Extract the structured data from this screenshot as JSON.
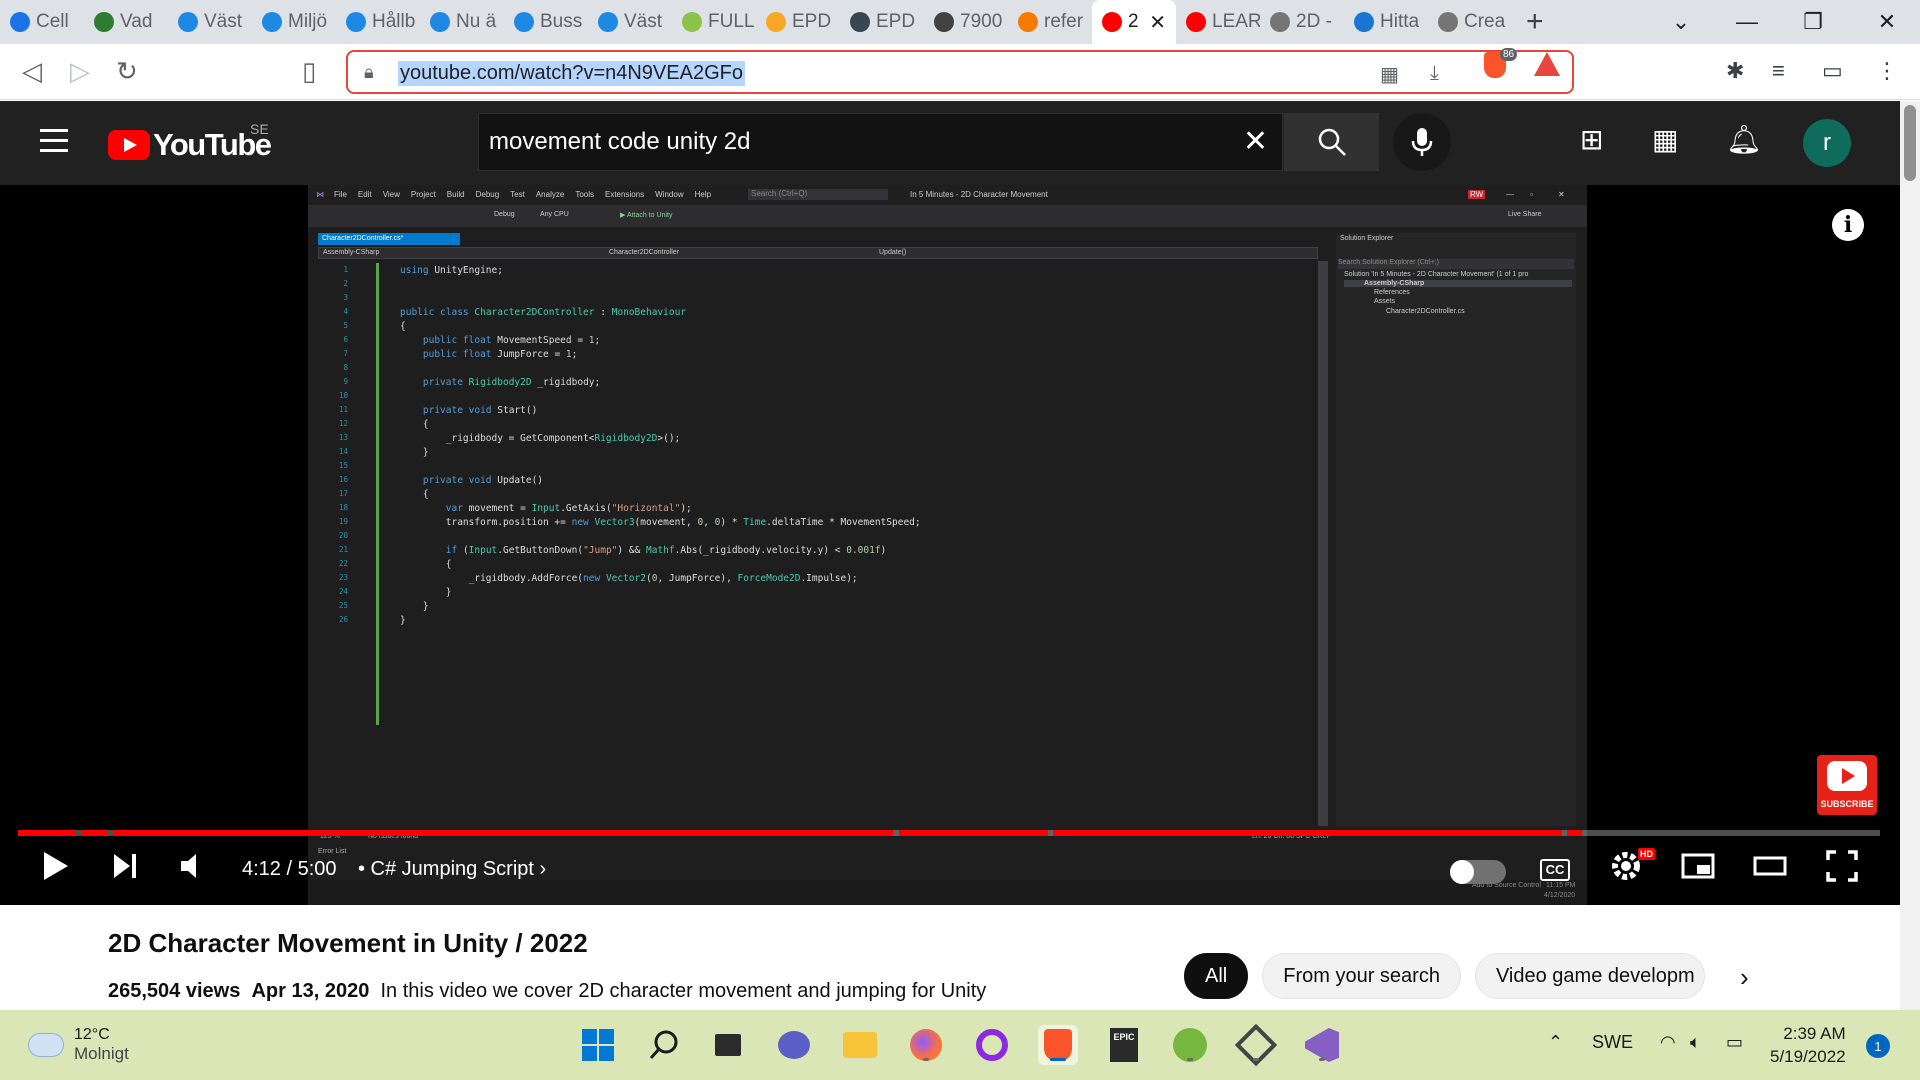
{
  "browser": {
    "tabs": [
      {
        "label": "Cell",
        "favicon": "c-icon",
        "color": "#1a73e8"
      },
      {
        "label": "Vad",
        "favicon": "vad-icon",
        "color": "#2e7d32"
      },
      {
        "label": "Väst",
        "favicon": "vastrafik-icon",
        "color": "#1e88e5"
      },
      {
        "label": "Miljö",
        "favicon": "vastrafik-icon",
        "color": "#1e88e5"
      },
      {
        "label": "Hållb",
        "favicon": "vastrafik-icon",
        "color": "#1e88e5"
      },
      {
        "label": "Nu ä",
        "favicon": "vastrafik-icon",
        "color": "#1e88e5"
      },
      {
        "label": "Buss",
        "favicon": "vastrafik-icon",
        "color": "#1e88e5"
      },
      {
        "label": "Väst",
        "favicon": "vastrafik-icon",
        "color": "#1e88e5"
      },
      {
        "label": "FULL",
        "favicon": "plant-icon",
        "color": "#8bc34a"
      },
      {
        "label": "EPD",
        "favicon": "epd-icon",
        "color": "#f9a825"
      },
      {
        "label": "EPD",
        "favicon": "epd-dark-icon",
        "color": "#37474f"
      },
      {
        "label": "7900",
        "favicon": "gauge-icon",
        "color": "#424242"
      },
      {
        "label": "refer",
        "favicon": "globe-icon",
        "color": "#f57c00"
      },
      {
        "label": "2",
        "favicon": "youtube-icon",
        "color": "#ff0000",
        "active": true
      },
      {
        "label": "LEAR",
        "favicon": "youtube-icon",
        "color": "#ff0000"
      },
      {
        "label": "2D -",
        "favicon": "unity-icon",
        "color": "#757575"
      },
      {
        "label": "Hitta",
        "favicon": "b-icon",
        "color": "#1976d2"
      },
      {
        "label": "Crea",
        "favicon": "unity-icon",
        "color": "#757575"
      }
    ],
    "url": "youtube.com/watch?v=n4N9VEA2GFo",
    "brave_badge": "86"
  },
  "youtube": {
    "logo_text": "YouTube",
    "region": "SE",
    "search_query": "movement code unity 2d",
    "avatar_letter": "r"
  },
  "player": {
    "current_time": "4:12",
    "duration": "5:00",
    "time_display": "4:12 / 5:00",
    "chapter": "• C# Jumping Script",
    "progress_fraction": 0.84,
    "subscribe_label": "SUBSCRIBE",
    "cc_label": "CC",
    "hd_label": "HD",
    "chapter_segments": [
      [
        0,
        0.031
      ],
      [
        0.034,
        0.048
      ],
      [
        0.051,
        0.47
      ],
      [
        0.473,
        0.553
      ],
      [
        0.556,
        0.829
      ],
      [
        0.832,
        0.84
      ]
    ]
  },
  "video_frame": {
    "menu": [
      "File",
      "Edit",
      "View",
      "Project",
      "Build",
      "Debug",
      "Test",
      "Analyze",
      "Tools",
      "Extensions",
      "Window",
      "Help"
    ],
    "search_placeholder": "Search (Ctrl+Q)",
    "window_title": "In 5 Minutes - 2D Character Movement",
    "toolbar_config": "Debug",
    "toolbar_platform": "Any CPU",
    "toolbar_attach": "▶ Attach to Unity",
    "user_badge": "RW",
    "live_share": "Live Share",
    "tab_label": "Character2DController.cs*",
    "nav_project": "Assembly-CSharp",
    "nav_class": "Character2DController",
    "nav_method": "Update()",
    "solution_explorer": {
      "title": "Solution Explorer",
      "search": "Search Solution Explorer (Ctrl+;)",
      "items": [
        "Solution 'In 5 Minutes - 2D Character Movement' (1 of 1 pro",
        "Assembly-CSharp",
        "References",
        "Assets",
        "Character2DController.cs"
      ]
    },
    "status_zoom": "123 %",
    "status_issues": "No issues found",
    "status_pos": "Ln: 20   Ch: 86   SPC   CRLF",
    "error_list": "Error List",
    "source_control": "Add to Source Control",
    "clock": "11:15 PM",
    "date": "4/12/2020"
  },
  "below": {
    "title": "2D Character Movement in Unity / 2022",
    "views": "265,504 views",
    "date": "Apr 13, 2020",
    "description": "In this video we cover 2D character movement and jumping for Unity",
    "chips": [
      "All",
      "From your search",
      "Video game developm"
    ]
  },
  "taskbar": {
    "temp": "12°C",
    "weather": "Molnigt",
    "lang": "SWE",
    "time": "2:39 AM",
    "date": "5/19/2022",
    "notifications": "1"
  }
}
